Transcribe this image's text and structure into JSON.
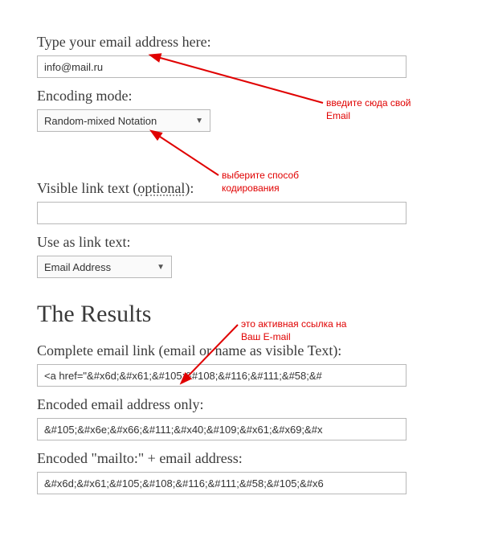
{
  "form": {
    "email_label": "Type your email address here:",
    "email_value": "info@mail.ru",
    "encoding_label": "Encoding mode:",
    "encoding_selected": "Random-mixed Notation",
    "visible_text_label_prefix": "Visible link text (",
    "visible_text_optional": "optional",
    "visible_text_label_suffix": "):",
    "visible_text_value": "",
    "use_as_label": "Use as link text:",
    "use_as_selected": "Email Address"
  },
  "results": {
    "heading": "The Results",
    "complete_label": "Complete email link (email or name as visible Text):",
    "complete_value": "<a href=\"&#x6d;&#x61;&#105;&#108;&#116;&#111;&#58;&#",
    "encoded_only_label": "Encoded email address only:",
    "encoded_only_value": "&#105;&#x6e;&#x66;&#111;&#x40;&#109;&#x61;&#x69;&#x",
    "mailto_label": "Encoded \"mailto:\" + email address:",
    "mailto_value": "&#x6d;&#x61;&#105;&#108;&#116;&#111;&#58;&#105;&#x6"
  },
  "annotations": {
    "enter_email": "введите сюда свой\nEmail",
    "choose_encoding": "выберите способ\nкодирования",
    "active_link": "это активная ссылка на\nВаш E-mail"
  },
  "colors": {
    "annotation": "#e00000",
    "text": "#3a3a3a",
    "border": "#b8b8b8"
  }
}
